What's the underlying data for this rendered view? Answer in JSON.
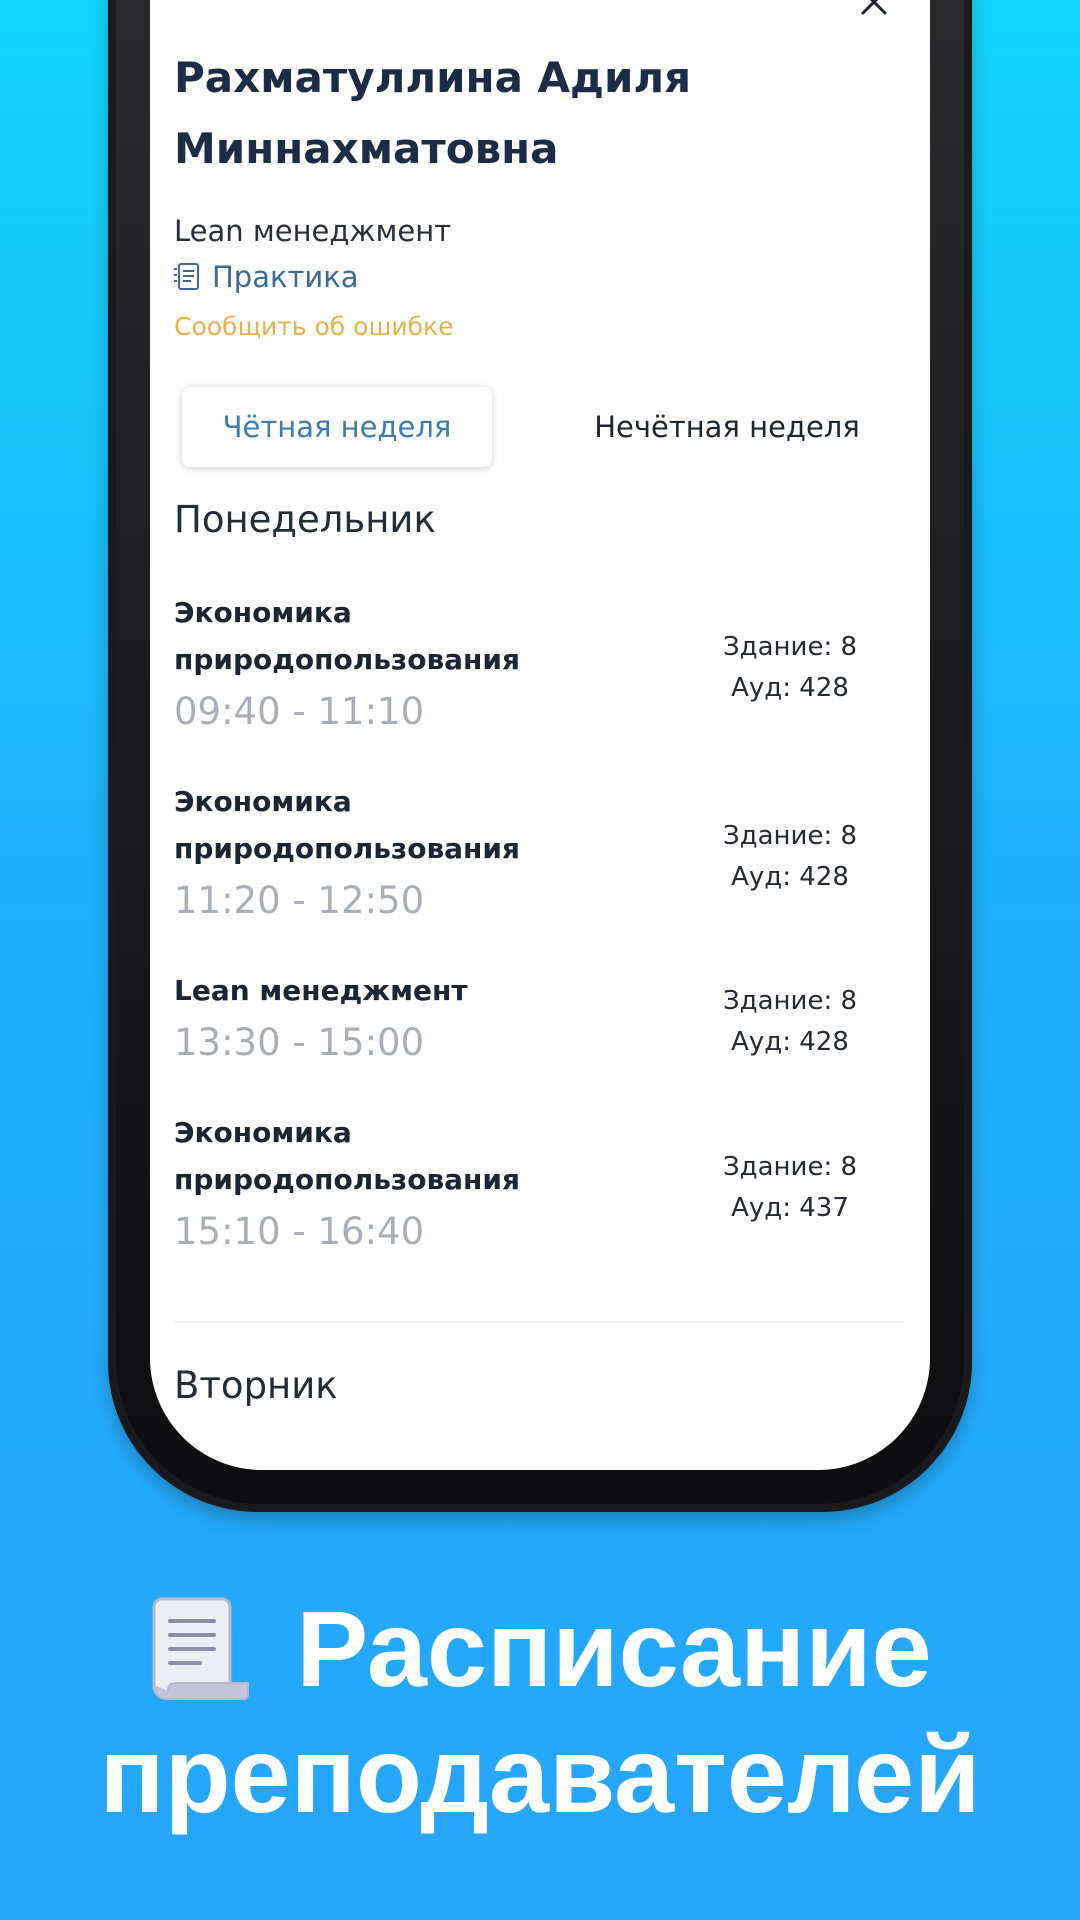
{
  "teacher": {
    "name": "Рахматуллина Адиля Миннахматовна",
    "subject": "Lean менеджмент",
    "lesson_type": "Практика",
    "report_error": "Сообщить об ошибке"
  },
  "tabs": [
    {
      "label": "Чётная неделя",
      "selected": true
    },
    {
      "label": "Нечётная неделя",
      "selected": false
    }
  ],
  "days": [
    {
      "name": "Понедельник",
      "lessons": [
        {
          "title": "Экономика природопользования",
          "time": "09:40 - 11:10",
          "building": "Здание: 8",
          "room": "Ауд: 428"
        },
        {
          "title": "Экономика природопользования",
          "time": "11:20 - 12:50",
          "building": "Здание: 8",
          "room": "Ауд: 428"
        },
        {
          "title": "Lean менеджмент",
          "time": "13:30 - 15:00",
          "building": "Здание: 8",
          "room": "Ауд: 428"
        },
        {
          "title": "Экономика природопользования",
          "time": "15:10 - 16:40",
          "building": "Здание: 8",
          "room": "Ауд: 437"
        }
      ]
    },
    {
      "name": "Вторник",
      "lessons": []
    }
  ],
  "caption": {
    "line1": "Расписание",
    "line2": "преподавателей"
  },
  "icons": {
    "close": "close-icon",
    "lesson_type": "document-list-icon",
    "caption": "scroll-icon"
  },
  "colors": {
    "background_top": "#12d6fb",
    "background_bottom": "#26a5fb",
    "title": "#1c2b46",
    "link": "#3d6a98",
    "warning": "#e9b14b",
    "time": "#a9afb7"
  }
}
